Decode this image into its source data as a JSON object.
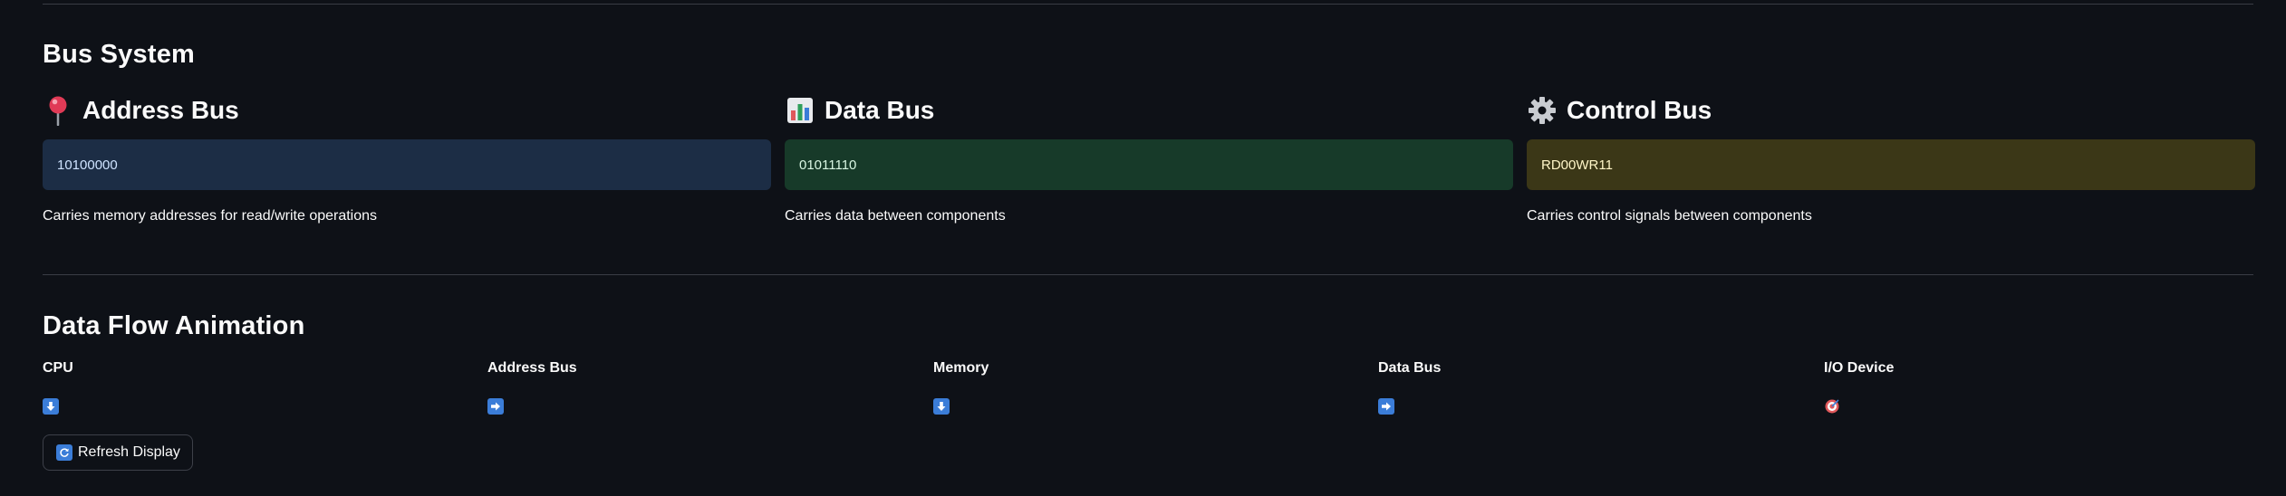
{
  "bus_system": {
    "title": "Bus System",
    "address": {
      "title": "Address Bus",
      "icon": "pushpin-icon",
      "value": "10100000",
      "description": "Carries memory addresses for read/write operations",
      "box_color": "#1c2d45",
      "text_color": "#cfe3ff"
    },
    "data": {
      "title": "Data Bus",
      "icon": "bar-chart-icon",
      "value": "01011110",
      "description": "Carries data between components",
      "box_color": "#173a29",
      "text_color": "#d8f5e2"
    },
    "control": {
      "title": "Control Bus",
      "icon": "gear-icon",
      "value": "RD00WR11",
      "description": "Carries control signals between components",
      "box_color": "#3b3717",
      "text_color": "#fff6c8"
    }
  },
  "data_flow": {
    "title": "Data Flow Animation",
    "steps": [
      {
        "label": "CPU",
        "icon": "arrow-down-icon"
      },
      {
        "label": "Address Bus",
        "icon": "arrow-right-icon"
      },
      {
        "label": "Memory",
        "icon": "arrow-down-icon"
      },
      {
        "label": "Data Bus",
        "icon": "arrow-right-icon"
      },
      {
        "label": "I/O Device",
        "icon": "target-icon"
      }
    ],
    "refresh_label": "Refresh Display",
    "refresh_icon": "refresh-icon"
  }
}
